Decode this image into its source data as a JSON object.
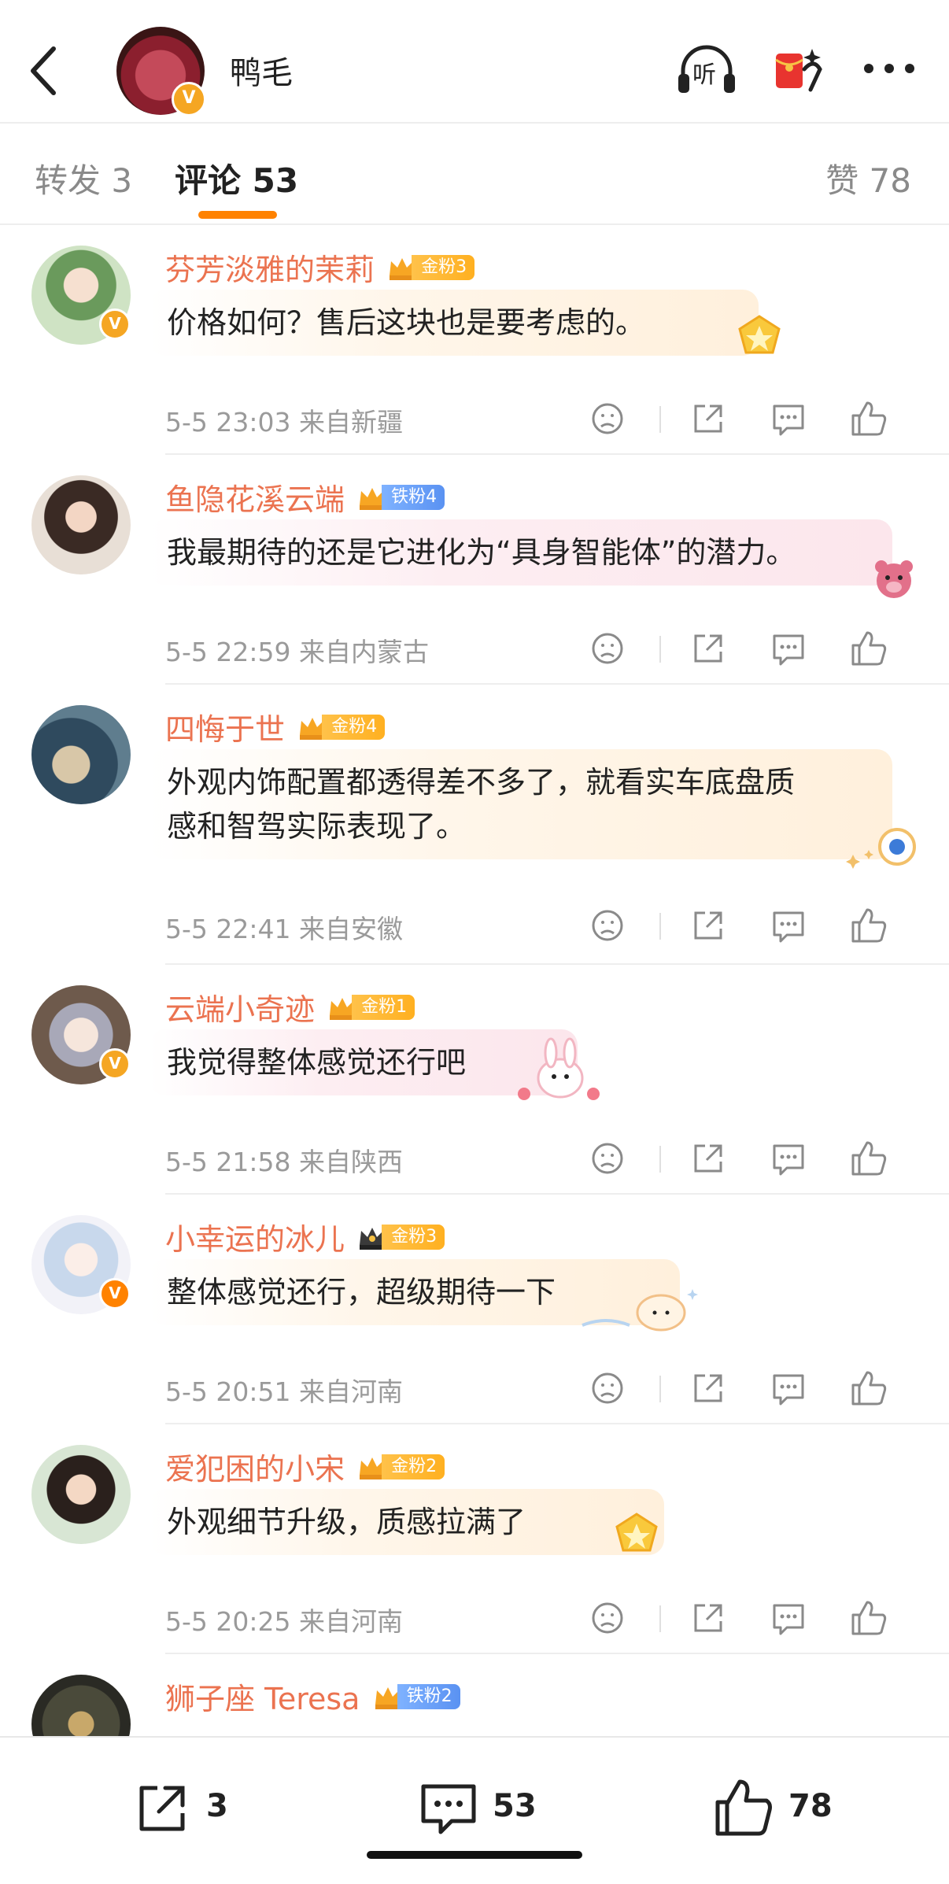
{
  "header": {
    "title": "鸭毛",
    "listen_label": "听",
    "verified_badge": "V"
  },
  "tabs": {
    "forward": "转发 3",
    "comment": "评论 53",
    "like": "赞 78"
  },
  "comments": [
    {
      "name": "芬芳淡雅的茉莉",
      "fan_level": "金粉3",
      "fan_type": "gold",
      "text": "价格如何？售后这块也是要考虑的。",
      "time": "5-5 23:03",
      "location": "来自新疆",
      "verified": "V"
    },
    {
      "name": "鱼隐花溪云端",
      "fan_level": "铁粉4",
      "fan_type": "iron",
      "text": "我最期待的还是它进化为“具身智能体”的潜力。",
      "time": "5-5 22:59",
      "location": "来自内蒙古"
    },
    {
      "name": "四悔于世",
      "fan_level": "金粉4",
      "fan_type": "gold",
      "text_line1": "外观内饰配置都透得差不多了，就看实车底盘质",
      "text_line2": "感和智驾实际表现了。",
      "time": "5-5 22:41",
      "location": "来自安徽"
    },
    {
      "name": "云端小奇迹",
      "fan_level": "金粉1",
      "fan_type": "gold",
      "text": "我觉得整体感觉还行吧",
      "time": "5-5 21:58",
      "location": "来自陕西",
      "verified": "V"
    },
    {
      "name": "小幸运的冰儿",
      "fan_level": "金粉3",
      "fan_type": "gold",
      "text": "整体感觉还行，超级期待一下",
      "time": "5-5 20:51",
      "location": "来自河南",
      "verified": "V"
    },
    {
      "name": "爱犯困的小宋",
      "fan_level": "金粉2",
      "fan_type": "gold",
      "text": "外观细节升级，质感拉满了",
      "time": "5-5 20:25",
      "location": "来自河南"
    },
    {
      "name": "狮子座 Teresa",
      "fan_level": "铁粉2",
      "fan_type": "iron",
      "text": "",
      "time": "",
      "location": ""
    }
  ],
  "bottom_bar": {
    "forward_count": "3",
    "comment_count": "53",
    "like_count": "78"
  },
  "colors": {
    "accent": "#ff8200",
    "username": "#eb7350",
    "meta": "#9a9a9a",
    "gold_badge": "#ffb020",
    "iron_badge": "#5a92f2"
  }
}
